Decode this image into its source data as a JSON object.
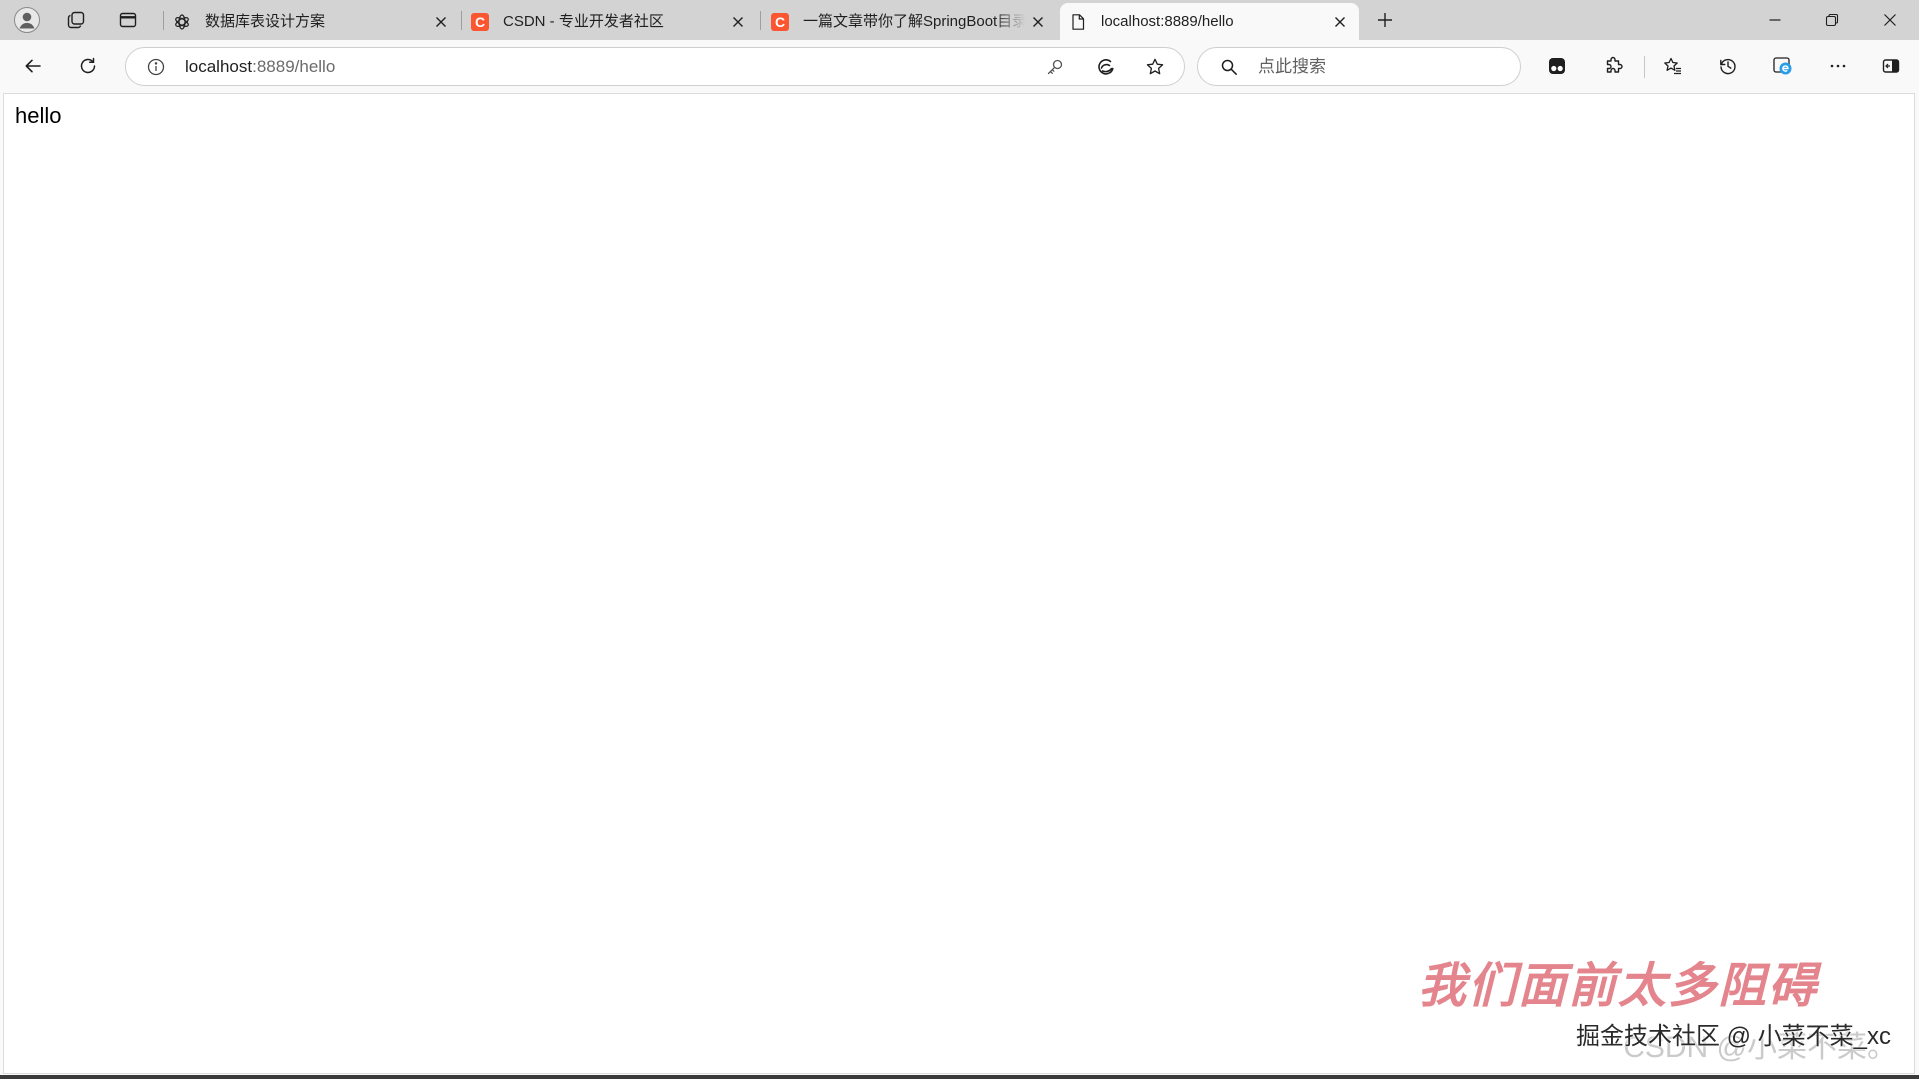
{
  "colors": {
    "tab_strip_bg": "#d3d3d3",
    "toolbar_bg": "#f9f9f9",
    "csdn_red": "#fc5531",
    "ie_blue": "#2a9ce8",
    "watermark_red": "#e06f79"
  },
  "window": {
    "left_icons": [
      "avatar-icon",
      "workspaces-icon",
      "tab-actions-icon"
    ],
    "new_tab_icon": "plus-icon",
    "controls": [
      "minimize-icon",
      "restore-icon",
      "close-icon"
    ]
  },
  "tab_strip": {
    "tabs": [
      {
        "title": "数据库表设计方案",
        "icon": "chatgpt-icon",
        "active": false
      },
      {
        "title": "CSDN - 专业开发者社区",
        "icon": "csdn-icon",
        "active": false
      },
      {
        "title": "一篇文章带你了解SpringBoot目录",
        "icon": "csdn-icon",
        "active": false
      },
      {
        "title": "localhost:8889/hello",
        "icon": "page-icon",
        "active": true
      }
    ],
    "csdn_logo_letter": "C"
  },
  "toolbar": {
    "nav_icons": [
      "back-arrow-icon",
      "refresh-icon"
    ],
    "address": {
      "host": "localhost",
      "path": ":8889/hello",
      "icons": [
        "info-icon",
        "key-icon",
        "edge-icon",
        "star-icon"
      ]
    },
    "search": {
      "placeholder": "点此搜索"
    },
    "right_icons": [
      "tampermonkey-icon",
      "puzzle-icon",
      "favorites-icon",
      "history-icon",
      "ie-mode-icon",
      "more-icon",
      "sidebar-icon"
    ]
  },
  "page": {
    "body_text": "hello"
  },
  "watermarks": {
    "slogan": "我们面前太多阻碍",
    "juejin": "掘金技术社区 @ 小菜不菜_xc",
    "csdn": "CSDN @小菜不菜。"
  }
}
